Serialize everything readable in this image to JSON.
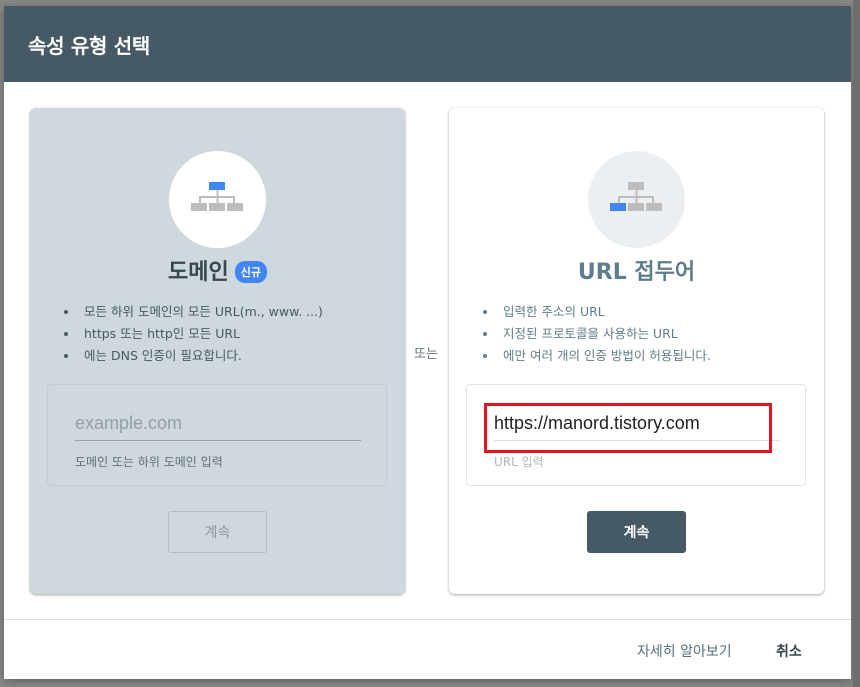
{
  "dialog": {
    "title": "속성 유형 선택",
    "or_label": "또는",
    "learn_more": "자세히 알아보기",
    "cancel": "취소"
  },
  "domain_card": {
    "icon": "sitemap-icon",
    "title": "도메인",
    "badge": "신규",
    "bullets": [
      "모든 하위 도메인의 모든 URL(m., www. ...)",
      "https 또는 http인 모든 URL",
      "에는 DNS 인증이 필요합니다."
    ],
    "input": {
      "value": "",
      "placeholder": "example.com",
      "hint": "도메인 또는 하위 도메인 입력"
    },
    "button": "계속"
  },
  "url_card": {
    "icon": "sitemap-icon",
    "title": "URL 접두어",
    "bullets": [
      "입력한 주소의 URL",
      "지정된 프로토콜을 사용하는 URL",
      "에만 여러 개의 인증 방법이 허용됩니다."
    ],
    "input": {
      "value": "https://manord.tistory.com",
      "placeholder": "",
      "hint": "URL 입력"
    },
    "button": "계속"
  },
  "colors": {
    "header": "#455a64",
    "accent_blue": "#4285f4",
    "highlight_red": "#e0141e",
    "domain_card_bg": "#cfd8dc"
  }
}
